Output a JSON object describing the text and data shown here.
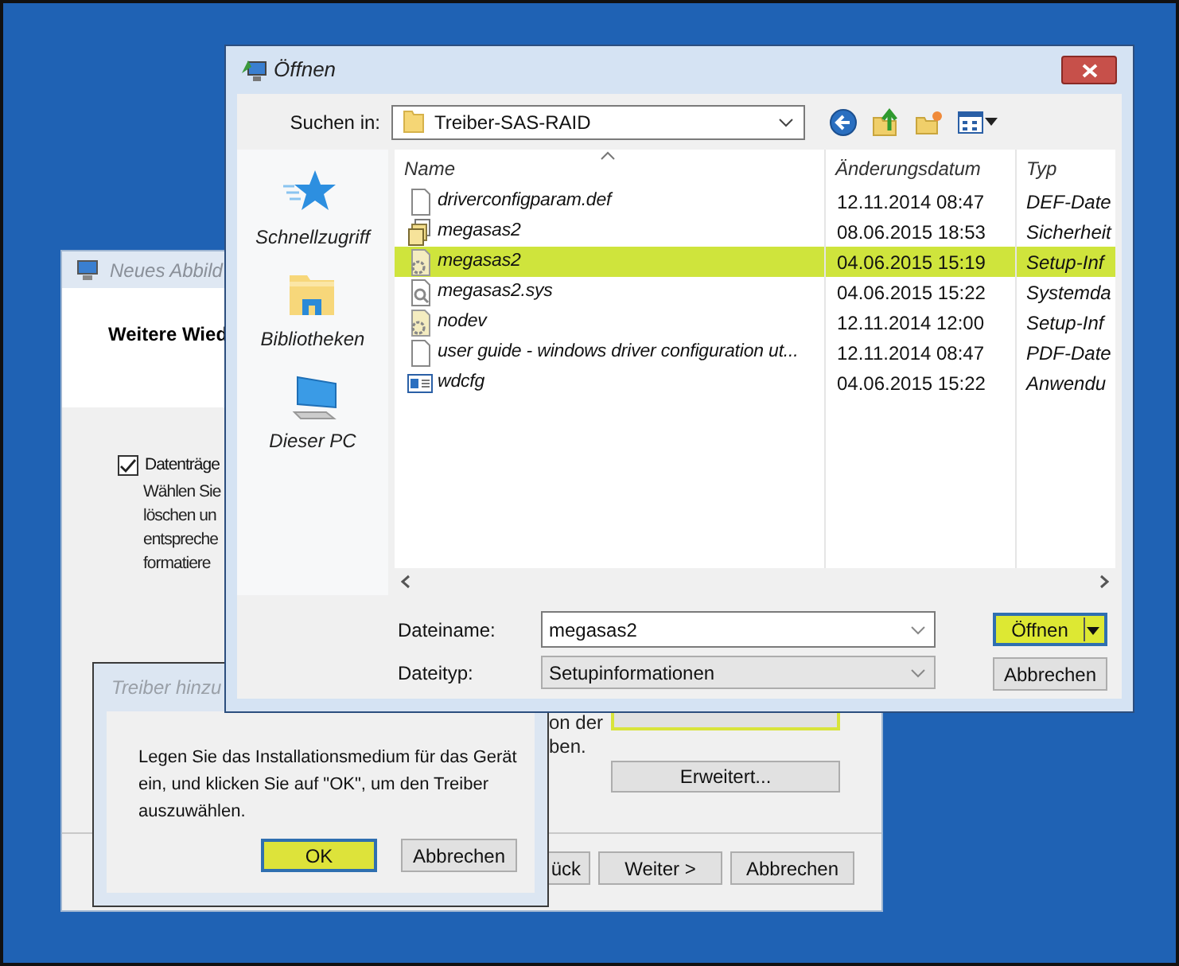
{
  "wizard": {
    "title": "Neues Abbild",
    "heading": "Weitere Wied",
    "option": {
      "label": "Datenträge",
      "checked": true
    },
    "description_lines": [
      "Wählen Sie",
      "löschen un",
      "entspreche",
      "formatiere"
    ],
    "fragments": [
      "on der",
      "ben."
    ],
    "buttons": [
      {
        "highlighted": true
      },
      {
        "label": "Erweitert...",
        "highlighted": false
      }
    ],
    "nav_buttons": [
      "ück",
      "Weiter >",
      "Abbrechen"
    ]
  },
  "open_dialog": {
    "title": "Öffnen",
    "look_in_label": "Suchen in:",
    "look_in_value": "Treiber-SAS-RAID",
    "places": [
      {
        "label": "Schnellzugriff",
        "kind": "star"
      },
      {
        "label": "Bibliotheken",
        "kind": "library"
      },
      {
        "label": "Dieser PC",
        "kind": "computer"
      }
    ],
    "columns": [
      "Name",
      "Änderungsdatum",
      "Typ"
    ],
    "files": [
      {
        "name": "driverconfigparam.def",
        "date": "12.11.2014 08:47",
        "type": "DEF-Date",
        "kind": "page",
        "selected": false
      },
      {
        "name": "megasas2",
        "date": "08.06.2015 18:53",
        "type": "Sicherheit",
        "kind": "catalog",
        "selected": false
      },
      {
        "name": "megasas2",
        "date": "04.06.2015 15:19",
        "type": "Setup-Inf",
        "kind": "setup",
        "selected": true
      },
      {
        "name": "megasas2.sys",
        "date": "04.06.2015 15:22",
        "type": "Systemda",
        "kind": "system",
        "selected": false
      },
      {
        "name": "nodev",
        "date": "12.11.2014 12:00",
        "type": "Setup-Inf",
        "kind": "setup",
        "selected": false
      },
      {
        "name": "user guide - windows driver configuration ut...",
        "date": "12.11.2014 08:47",
        "type": "PDF-Date",
        "kind": "page",
        "selected": false
      },
      {
        "name": "wdcfg",
        "date": "04.06.2015 15:22",
        "type": "Anwendu",
        "kind": "application",
        "selected": false
      }
    ],
    "file_name_label": "Dateiname:",
    "file_name": "megasas2",
    "file_type_label": "Dateityp:",
    "file_type": "Setupinformationen",
    "buttons": [
      {
        "label": "Öffnen",
        "highlighted": true,
        "kind": "split"
      },
      {
        "label": "Abbrechen",
        "highlighted": false,
        "kind": "plain"
      }
    ]
  },
  "driver_dialog": {
    "title": "Treiber hinzu",
    "message": "Legen Sie das Installationsmedium für das Gerät ein, und klicken Sie auf \"OK\", um den Treiber auszuwählen.",
    "buttons": [
      {
        "label": "OK",
        "highlighted": true
      },
      {
        "label": "Abbrechen",
        "highlighted": false
      }
    ]
  }
}
